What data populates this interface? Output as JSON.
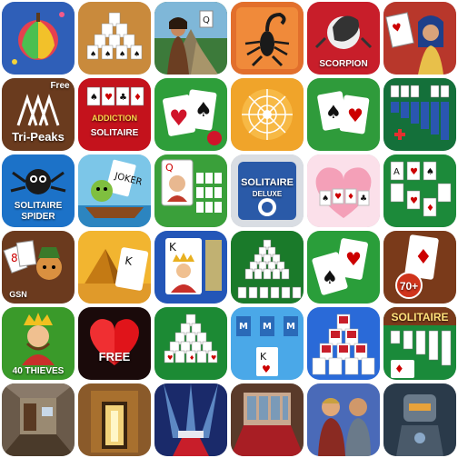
{
  "apps": {
    "tripeaks": {
      "free": "Free",
      "name": "Tri-Peaks"
    },
    "addiction": {
      "top": "ADDICTION",
      "name": "SOLITAIRE"
    },
    "scorpion": {
      "name": "SCORPION"
    },
    "spider": {
      "top": "SOLITAIRE",
      "name": "SPIDER"
    },
    "deluxe": {
      "name": "SOLITAIRE",
      "sub": "DELUXE"
    },
    "gsn": {
      "name": "GSN"
    },
    "seventy": {
      "name": "70+"
    },
    "freehearts": {
      "name": "FREE"
    },
    "thieves": {
      "name": "40 THIEVES"
    },
    "solitaire_big": {
      "name": "SOLITAIRE"
    }
  },
  "icon_names": [
    "fruit-icon",
    "pyramid-icon",
    "temple-icon",
    "scorpion-icon",
    "scorpion-logo-icon",
    "pharaoh-icon",
    "tripeaks-icon",
    "addiction-solitaire-icon",
    "card-app-icon",
    "spider-web-icon",
    "cards-icon",
    "klondike-icon",
    "spider-solitaire-icon",
    "jester-boat-icon",
    "queen-card-icon",
    "solitaire-deluxe-icon",
    "heart-cards-icon",
    "green-solitaire-icon",
    "gsn-icon",
    "pyramid-desert-icon",
    "king-card-icon",
    "pyramid-green-icon",
    "spade-card-icon",
    "seventy-plus-icon",
    "forty-thieves-icon",
    "free-hearts-icon",
    "pyramid-cards-icon",
    "tripeaks-blue-icon",
    "red-pyramid-icon",
    "solitaire-classic-icon",
    "room-escape-icon",
    "door-escape-icon",
    "stage-escape-icon",
    "room-red-icon",
    "heroes-icon",
    "robot-icon"
  ]
}
